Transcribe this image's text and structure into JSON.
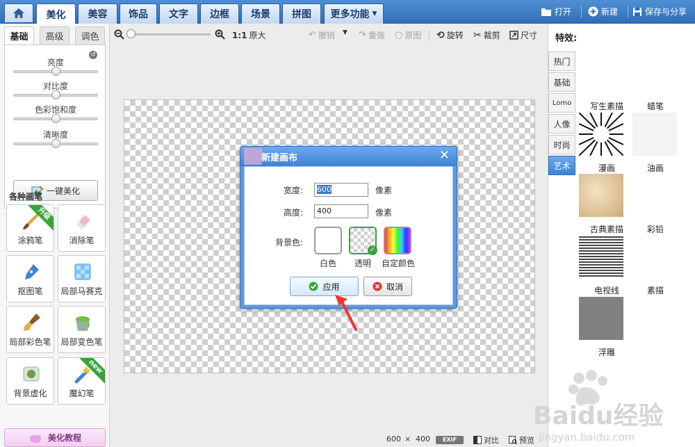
{
  "topbar": {
    "tabs": [
      "美化",
      "美容",
      "饰品",
      "文字",
      "边框",
      "场景",
      "拼图",
      "更多功能"
    ],
    "active_tab": "美化",
    "actions": {
      "open": "打开",
      "new": "新建",
      "save_share": "保存与分享"
    }
  },
  "left": {
    "subtabs": [
      "基础",
      "高级",
      "调色"
    ],
    "sliders": [
      {
        "label": "亮度",
        "value": 0.5
      },
      {
        "label": "对比度",
        "value": 0.5
      },
      {
        "label": "色彩饱和度",
        "value": 0.5
      },
      {
        "label": "清晰度",
        "value": 0.5
      }
    ],
    "onekey": "一键美化",
    "brushes_title": "各种画笔",
    "brushes": [
      "涂鸦笔",
      "消除笔",
      "抠图笔",
      "局部马赛克",
      "局部彩色笔",
      "局部变色笔",
      "背景虚化",
      "魔幻笔"
    ],
    "badges": {
      "upgrade": "升级",
      "new": "new"
    },
    "tutorial": "美化教程"
  },
  "toolbar": {
    "ratio": "1:1",
    "original_size": "原大",
    "undo": "撤销",
    "redo": "重做",
    "original": "原图",
    "rotate": "旋转",
    "crop": "裁剪",
    "size": "尺寸"
  },
  "dialog": {
    "title": "新建画布",
    "width_label": "宽度:",
    "width_value": "600",
    "height_label": "高度:",
    "height_value": "400",
    "unit": "像素",
    "bg_label": "背景色:",
    "options": [
      "白色",
      "透明",
      "自定颜色"
    ],
    "selected_option": "透明",
    "apply": "应用",
    "cancel": "取消"
  },
  "status": {
    "width": "600",
    "times": "×",
    "height": "400",
    "exif": "EXIF",
    "compare": "对比",
    "preview": "预览"
  },
  "right": {
    "title": "特效:",
    "categories": [
      "热门",
      "基础",
      "Lomo",
      "人像",
      "时尚",
      "艺术"
    ],
    "active_category": "艺术",
    "effects": [
      "写生素描",
      "蜡笔",
      "漫画",
      "油画",
      "古典素描",
      "彩铅",
      "电视线",
      "素描",
      "浮雕"
    ]
  },
  "watermark": {
    "brand": "Baidu经验",
    "url": "jingyan.baidu.com"
  },
  "colors": {
    "accent": "#3f82d2",
    "topbar": "#2f6fb7",
    "check_green": "#3aa33a",
    "cancel_red": "#d33"
  }
}
